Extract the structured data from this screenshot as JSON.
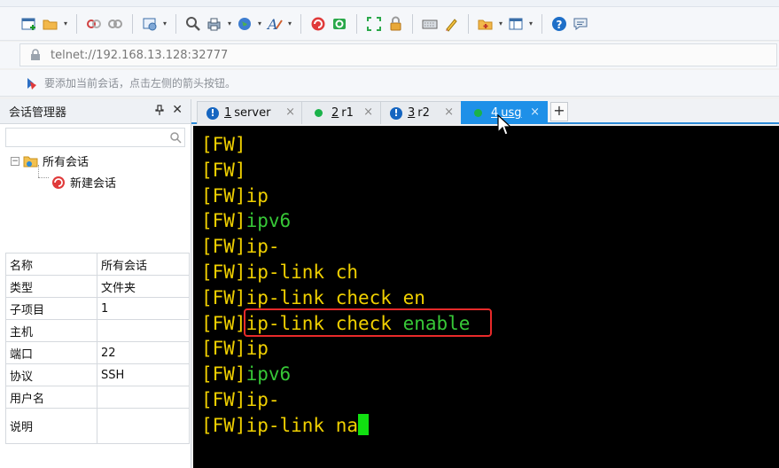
{
  "address_bar": {
    "value": "telnet://192.168.13.128:32777"
  },
  "hint_bar": {
    "text": "要添加当前会话，点击左侧的箭头按钮。"
  },
  "session_manager": {
    "title": "会话管理器",
    "pin_symbol": "📌",
    "close_symbol": "✕",
    "search_placeholder": "",
    "tree": {
      "root_label": "所有会话",
      "child_label": "新建会话"
    },
    "properties": [
      {
        "key": "名称",
        "value": "所有会话"
      },
      {
        "key": "类型",
        "value": "文件夹"
      },
      {
        "key": "子项目",
        "value": "1"
      },
      {
        "key": "主机",
        "value": ""
      },
      {
        "key": "端口",
        "value": "22"
      },
      {
        "key": "协议",
        "value": "SSH"
      },
      {
        "key": "用户名",
        "value": ""
      },
      {
        "key": "说明",
        "value": ""
      }
    ]
  },
  "tabs": [
    {
      "num": "1",
      "label": "server",
      "status": "warning",
      "active": false
    },
    {
      "num": "2",
      "label": "r1",
      "status": "connected",
      "active": false
    },
    {
      "num": "3",
      "label": "r2",
      "status": "warning",
      "active": false
    },
    {
      "num": "4",
      "label": "usg",
      "status": "connected",
      "active": true
    }
  ],
  "add_tab_label": "+",
  "tab_close_symbol": "×",
  "warning_symbol": "!",
  "terminal": {
    "prompt": "[FW]",
    "lines": [
      {
        "cmd": "",
        "completion": ""
      },
      {
        "cmd": "",
        "completion": ""
      },
      {
        "cmd": "ip",
        "completion": ""
      },
      {
        "cmd": "",
        "completion": "ipv6"
      },
      {
        "cmd": "ip-",
        "completion": ""
      },
      {
        "cmd": "ip-link ch",
        "completion": ""
      },
      {
        "cmd": "ip-link check en",
        "completion": ""
      },
      {
        "cmd": "ip-link check ",
        "completion": "enable"
      },
      {
        "cmd": "ip",
        "completion": ""
      },
      {
        "cmd": "",
        "completion": "ipv6"
      },
      {
        "cmd": "ip-",
        "completion": ""
      },
      {
        "cmd": "ip-link na",
        "completion": ""
      }
    ],
    "colors": {
      "background": "#000000",
      "text": "#f0d000",
      "completion": "#37c837",
      "cursor": "#11e011",
      "highlight": "#e82a2a"
    }
  }
}
